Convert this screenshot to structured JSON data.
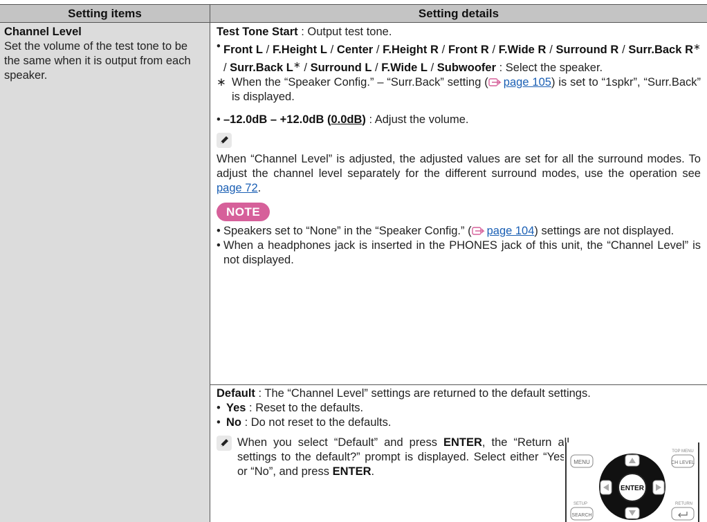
{
  "header": {
    "col1": "Setting items",
    "col2": "Setting details"
  },
  "item": {
    "title": "Channel Level",
    "desc": "Set the volume of the test tone to be the same when it is output from each speaker."
  },
  "row1": {
    "test_tone_label": "Test Tone Start",
    "test_tone_desc": " : Output test tone.",
    "speakers": [
      "Front L",
      "F.Height L",
      "Center",
      "F.Height R",
      "Front R",
      "F.Wide R",
      "Surround R",
      "Surr.Back R",
      "Surr.Back L",
      "Surround L",
      "F.Wide L",
      "Subwoofer"
    ],
    "speakers_desc": " : Select the speaker.",
    "asterisk": "∗",
    "asterisk_note_1": "When the “Speaker Config.” – “Surr.Back” setting (",
    "asterisk_link": "page 105",
    "asterisk_note_2": ") is set to “1spkr”, “Surr.Back” is displayed.",
    "range_label": "–12.0dB – +12.0dB (",
    "range_default": "0.0dB",
    "range_close": ")",
    "range_desc": " : Adjust the volume.",
    "memo_text": "When “Channel Level” is adjusted, the adjusted values are set for all the surround modes. To adjust the channel level separately for the different surround modes, use the operation see ",
    "memo_link": "page 72",
    "memo_end": ".",
    "note_label": "NOTE",
    "note1_a": "Speakers set to “None” in the “Speaker Config.” (",
    "note1_link": "page 104",
    "note1_b": ") settings are not displayed.",
    "note2": "When a headphones jack is inserted in the PHONES jack of this unit, the “Channel Level” is not displayed."
  },
  "row2": {
    "default_label": "Default",
    "default_desc": " : The “Channel Level” settings are returned to the default settings.",
    "yes_label": "Yes",
    "yes_desc": " : Reset to the defaults.",
    "no_label": "No",
    "no_desc": " : Do not reset to the defaults.",
    "tip_a": "When you select “Default” and press ",
    "tip_enter": "ENTER",
    "tip_b": ", the “Return all settings to the default?” prompt is displayed. Select either “Yes” or “No”, and press ",
    "tip_end": "."
  },
  "remote": {
    "menu": "MENU",
    "top_menu": "TOP MENU",
    "ch_level": "CH LEVEL",
    "enter": "ENTER",
    "setup": "SETUP",
    "search": "SEARCH",
    "return": "RETURN"
  }
}
